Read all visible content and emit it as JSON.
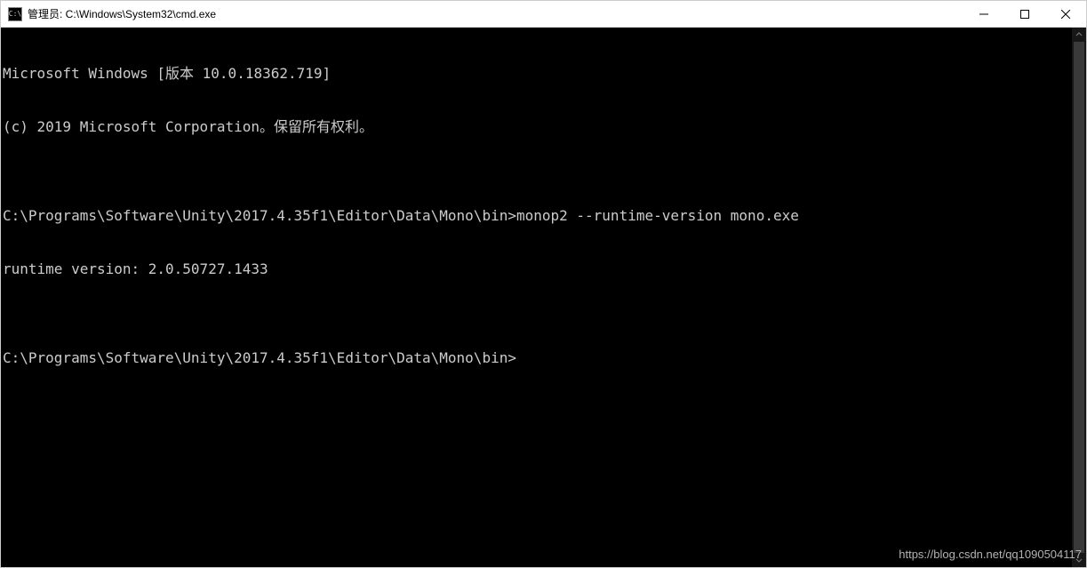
{
  "titlebar": {
    "icon_label": "C:\\",
    "title": "管理员: C:\\Windows\\System32\\cmd.exe"
  },
  "terminal": {
    "lines": [
      "Microsoft Windows [版本 10.0.18362.719]",
      "(c) 2019 Microsoft Corporation。保留所有权利。",
      "",
      "C:\\Programs\\Software\\Unity\\2017.4.35f1\\Editor\\Data\\Mono\\bin>monop2 --runtime-version mono.exe",
      "runtime version: 2.0.50727.1433",
      "",
      "C:\\Programs\\Software\\Unity\\2017.4.35f1\\Editor\\Data\\Mono\\bin>"
    ]
  },
  "watermark": "https://blog.csdn.net/qq1090504117"
}
